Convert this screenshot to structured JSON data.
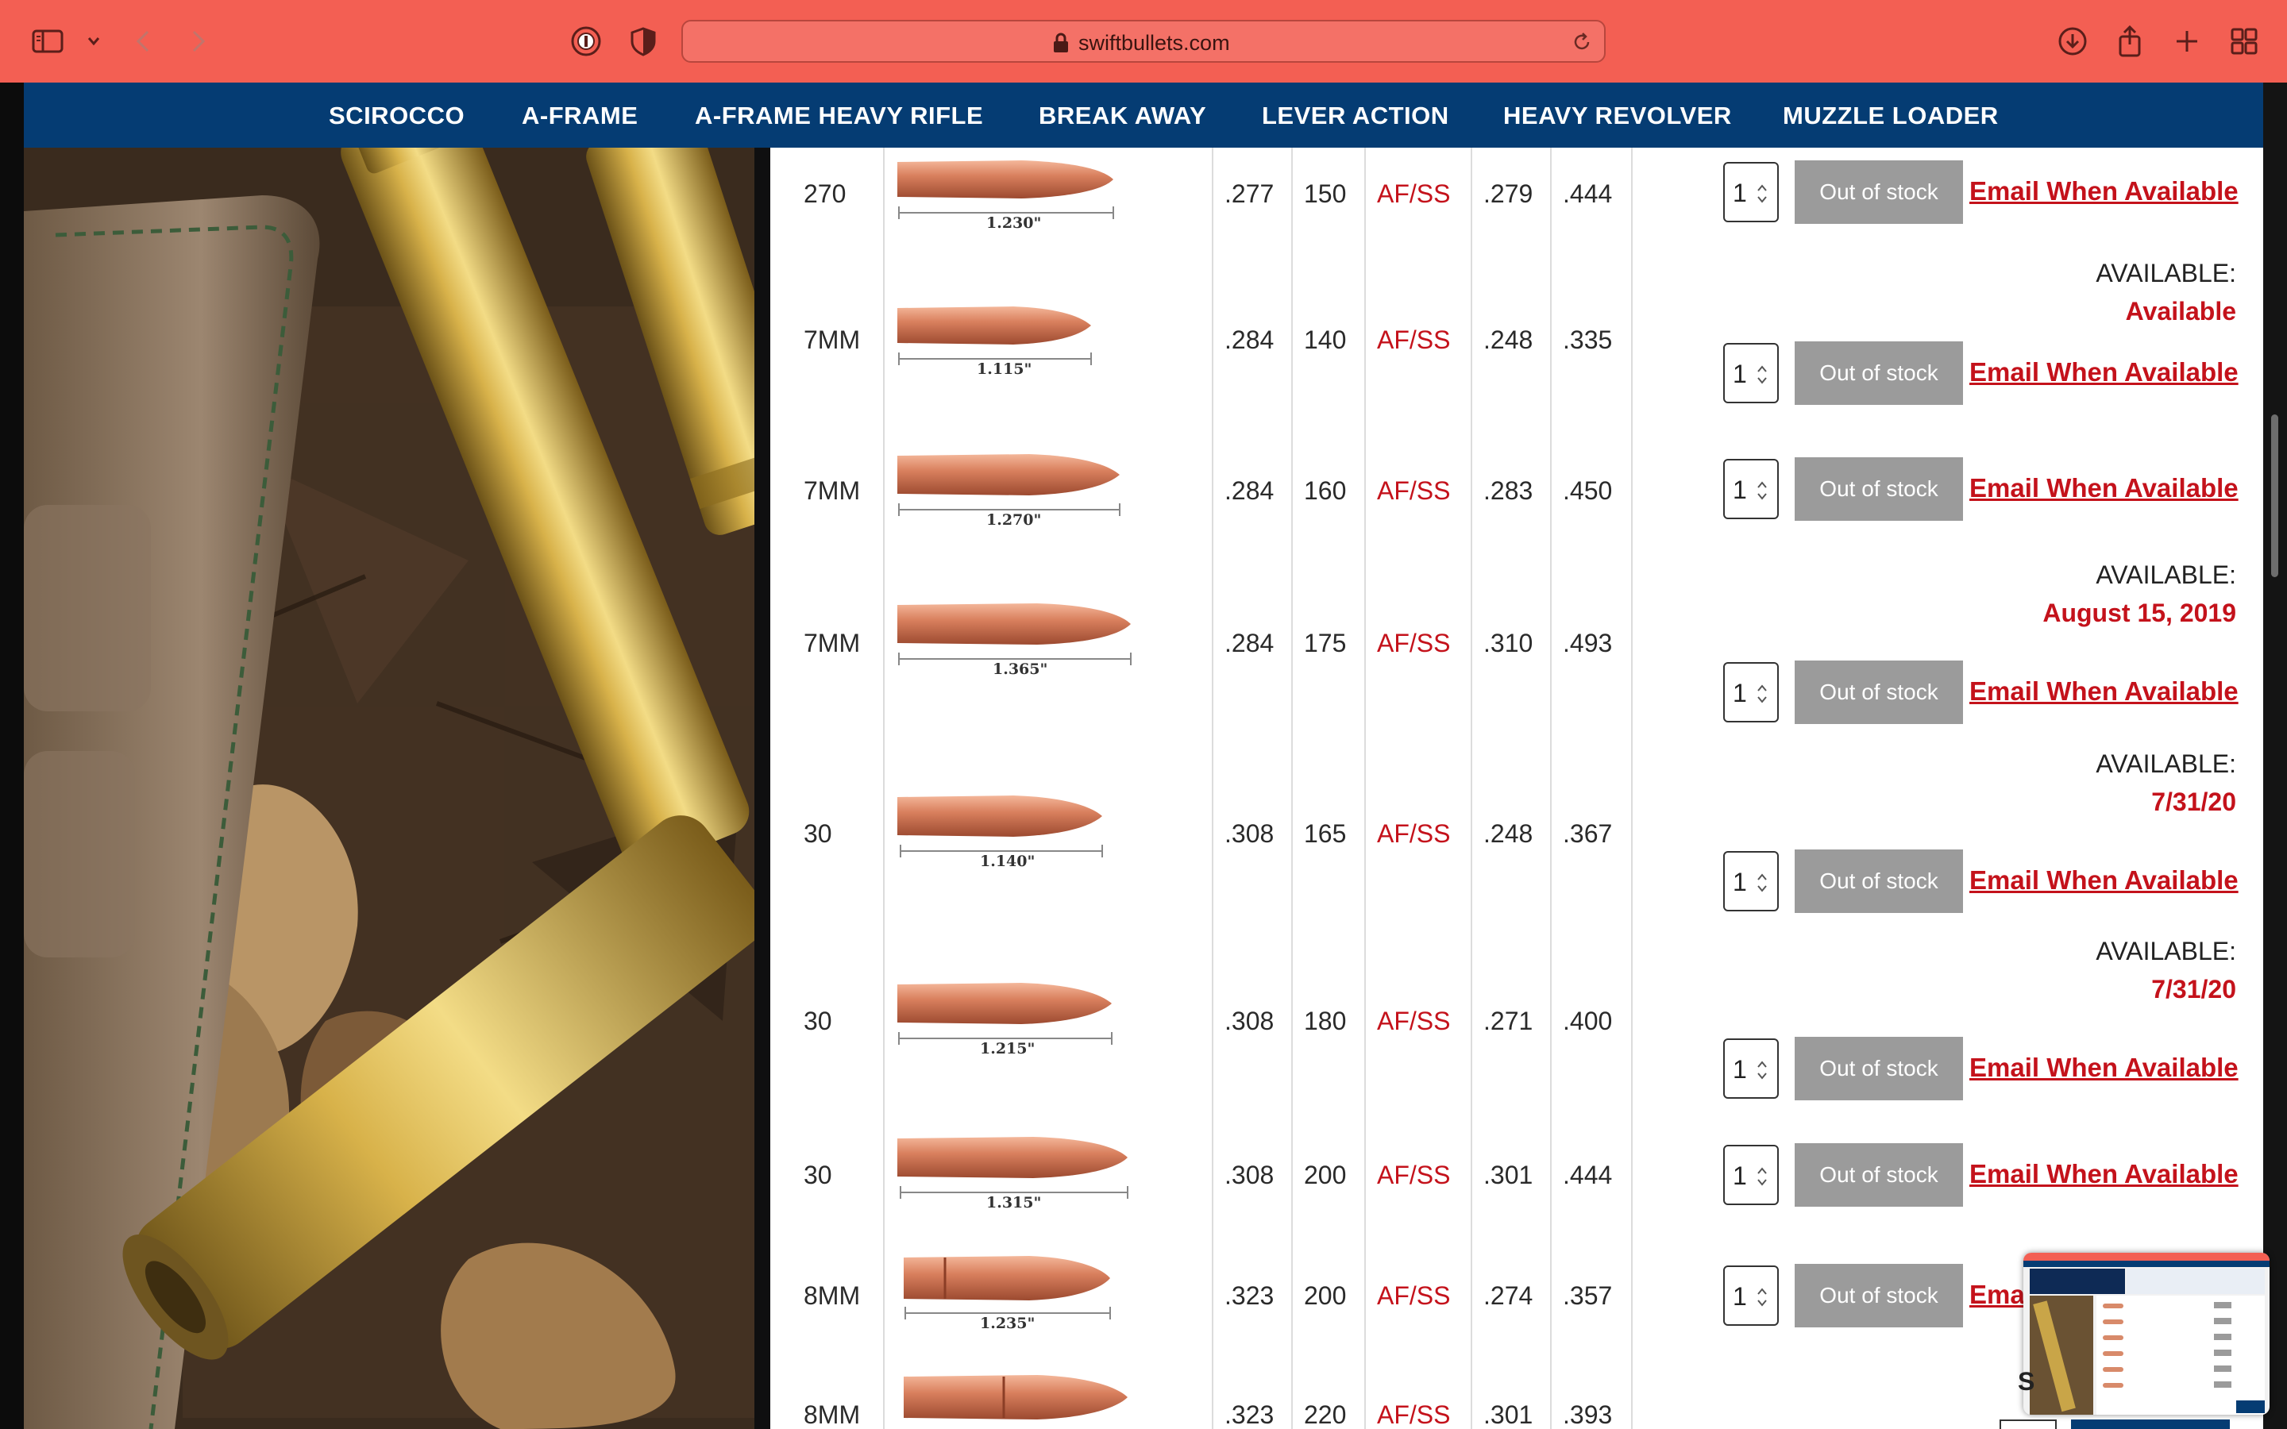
{
  "browser": {
    "url": "swiftbullets.com",
    "icons": [
      "sidebar-icon",
      "chevron-down-icon",
      "back-icon",
      "forward-icon",
      "password-icon",
      "shield-icon",
      "lock-icon",
      "reload-icon",
      "download-icon",
      "share-icon",
      "new-tab-icon",
      "tab-overview-icon"
    ]
  },
  "nav": {
    "items": [
      "SCIROCCO",
      "A-FRAME",
      "A-FRAME HEAVY RIFLE",
      "BREAK AWAY",
      "LEVER ACTION",
      "HEAVY REVOLVER",
      "MUZZLE LOADER"
    ]
  },
  "colors": {
    "toolbar": "#f35f53",
    "nav_bg": "#053c73",
    "accent_red": "#c4121b",
    "button_gray": "#9b9b9b"
  },
  "table": {
    "rows": [
      {
        "caliber": "270",
        "length": "1.230\"",
        "diameter": ".277",
        "weight": "150",
        "type": "AF/SS",
        "bc": ".279",
        "sd": ".444",
        "qty": "1",
        "stock_button": "Out of stock",
        "email": "Email When Available",
        "available_label": "",
        "available_value": ""
      },
      {
        "caliber": "7MM",
        "length": "1.115\"",
        "diameter": ".284",
        "weight": "140",
        "type": "AF/SS",
        "bc": ".248",
        "sd": ".335",
        "qty": "1",
        "stock_button": "Out of stock",
        "email": "Email When Available",
        "available_label": "AVAILABLE:",
        "available_value": "Available"
      },
      {
        "caliber": "7MM",
        "length": "1.270\"",
        "diameter": ".284",
        "weight": "160",
        "type": "AF/SS",
        "bc": ".283",
        "sd": ".450",
        "qty": "1",
        "stock_button": "Out of stock",
        "email": "Email When Available",
        "available_label": "",
        "available_value": ""
      },
      {
        "caliber": "7MM",
        "length": "1.365\"",
        "diameter": ".284",
        "weight": "175",
        "type": "AF/SS",
        "bc": ".310",
        "sd": ".493",
        "qty": "1",
        "stock_button": "Out of stock",
        "email": "Email When Available",
        "available_label": "AVAILABLE:",
        "available_value": "August 15, 2019"
      },
      {
        "caliber": "30",
        "length": "1.140\"",
        "diameter": ".308",
        "weight": "165",
        "type": "AF/SS",
        "bc": ".248",
        "sd": ".367",
        "qty": "1",
        "stock_button": "Out of stock",
        "email": "Email When Available",
        "available_label": "AVAILABLE:",
        "available_value": "7/31/20"
      },
      {
        "caliber": "30",
        "length": "1.215\"",
        "diameter": ".308",
        "weight": "180",
        "type": "AF/SS",
        "bc": ".271",
        "sd": ".400",
        "qty": "1",
        "stock_button": "Out of stock",
        "email": "Email When Available",
        "available_label": "AVAILABLE:",
        "available_value": "7/31/20"
      },
      {
        "caliber": "30",
        "length": "1.315\"",
        "diameter": ".308",
        "weight": "200",
        "type": "AF/SS",
        "bc": ".301",
        "sd": ".444",
        "qty": "1",
        "stock_button": "Out of stock",
        "email": "Email When Available",
        "available_label": "",
        "available_value": ""
      },
      {
        "caliber": "8MM",
        "length": "1.235\"",
        "diameter": ".323",
        "weight": "200",
        "type": "AF/SS",
        "bc": ".274",
        "sd": ".357",
        "qty": "1",
        "stock_button": "Out of stock",
        "email": "Emai",
        "available_label": "",
        "available_value": ""
      },
      {
        "caliber": "8MM",
        "length": "",
        "diameter": ".323",
        "weight": "220",
        "type": "AF/SS",
        "bc": ".301",
        "sd": ".393",
        "qty": "",
        "stock_button": "",
        "email": "",
        "available_label": "",
        "available_value": ""
      }
    ]
  },
  "overlay": {
    "partial_text": "S"
  }
}
